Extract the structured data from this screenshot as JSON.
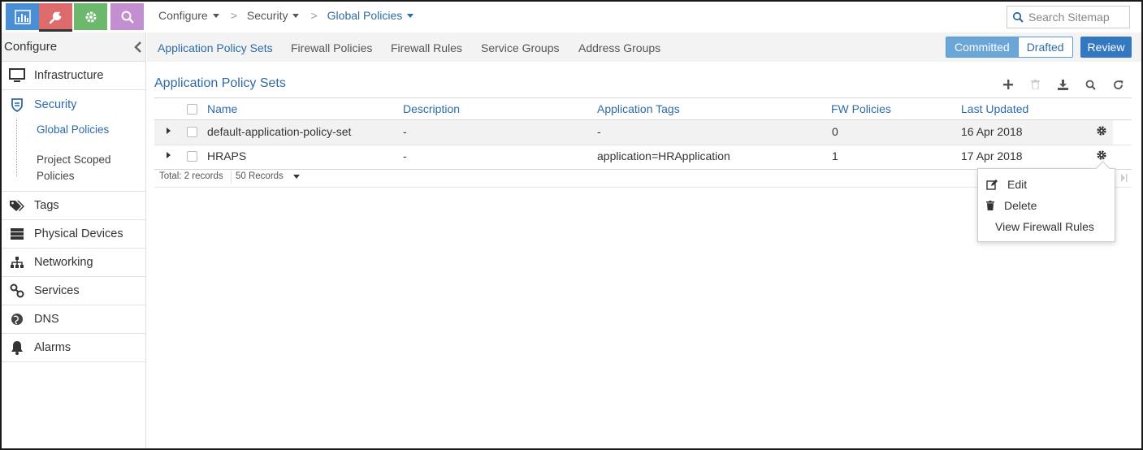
{
  "colors": {
    "accent": "#2d6ba8",
    "app_monitor": "#4a8ed6",
    "app_configure": "#dd6b6b",
    "app_settings": "#6cb86c",
    "app_query": "#c48fd0",
    "review": "#3578c2",
    "committed": "#6aa6d8"
  },
  "app_switcher": [
    {
      "name": "monitor",
      "icon": "bar-chart-icon"
    },
    {
      "name": "configure",
      "icon": "wrench-icon"
    },
    {
      "name": "settings",
      "icon": "gear-icon"
    },
    {
      "name": "query",
      "icon": "search-icon"
    }
  ],
  "breadcrumb": {
    "items": [
      "Configure",
      "Security",
      "Global Policies"
    ]
  },
  "search": {
    "placeholder": "Search Sitemap"
  },
  "sidebar": {
    "title": "Configure",
    "items": [
      {
        "label": "Infrastructure",
        "icon": "monitor-icon"
      },
      {
        "label": "Security",
        "icon": "shield-icon"
      },
      {
        "label": "Tags",
        "icon": "tags-icon"
      },
      {
        "label": "Physical Devices",
        "icon": "server-icon"
      },
      {
        "label": "Networking",
        "icon": "network-icon"
      },
      {
        "label": "Services",
        "icon": "link-icon"
      },
      {
        "label": "DNS",
        "icon": "globe-icon"
      },
      {
        "label": "Alarms",
        "icon": "bell-icon"
      }
    ],
    "subitems": [
      "Global Policies",
      "Project Scoped",
      "Policies"
    ]
  },
  "tabs": [
    "Application Policy Sets",
    "Firewall Policies",
    "Firewall Rules",
    "Service Groups",
    "Address Groups"
  ],
  "mode": {
    "committed": "Committed",
    "drafted": "Drafted",
    "review": "Review"
  },
  "grid": {
    "title": "Application Policy Sets",
    "toolbar": [
      "add-icon",
      "delete-icon",
      "download-icon",
      "search-icon",
      "refresh-icon"
    ],
    "columns": [
      "Name",
      "Description",
      "Application Tags",
      "FW Policies",
      "Last Updated"
    ],
    "rows": [
      {
        "name": "default-application-policy-set",
        "description": "-",
        "tags": "-",
        "fw": "0",
        "updated": "16 Apr 2018"
      },
      {
        "name": "HRAPS",
        "description": "-",
        "tags": "application=HRApplication",
        "fw": "1",
        "updated": "17 Apr 2018"
      }
    ],
    "footer": {
      "total": "Total: 2 records",
      "page_size": "50 Records"
    }
  },
  "context_menu": {
    "items": [
      {
        "label": "Edit",
        "icon": "edit-icon"
      },
      {
        "label": "Delete",
        "icon": "trash-icon"
      },
      {
        "label": "View Firewall Rules",
        "icon": ""
      }
    ]
  }
}
